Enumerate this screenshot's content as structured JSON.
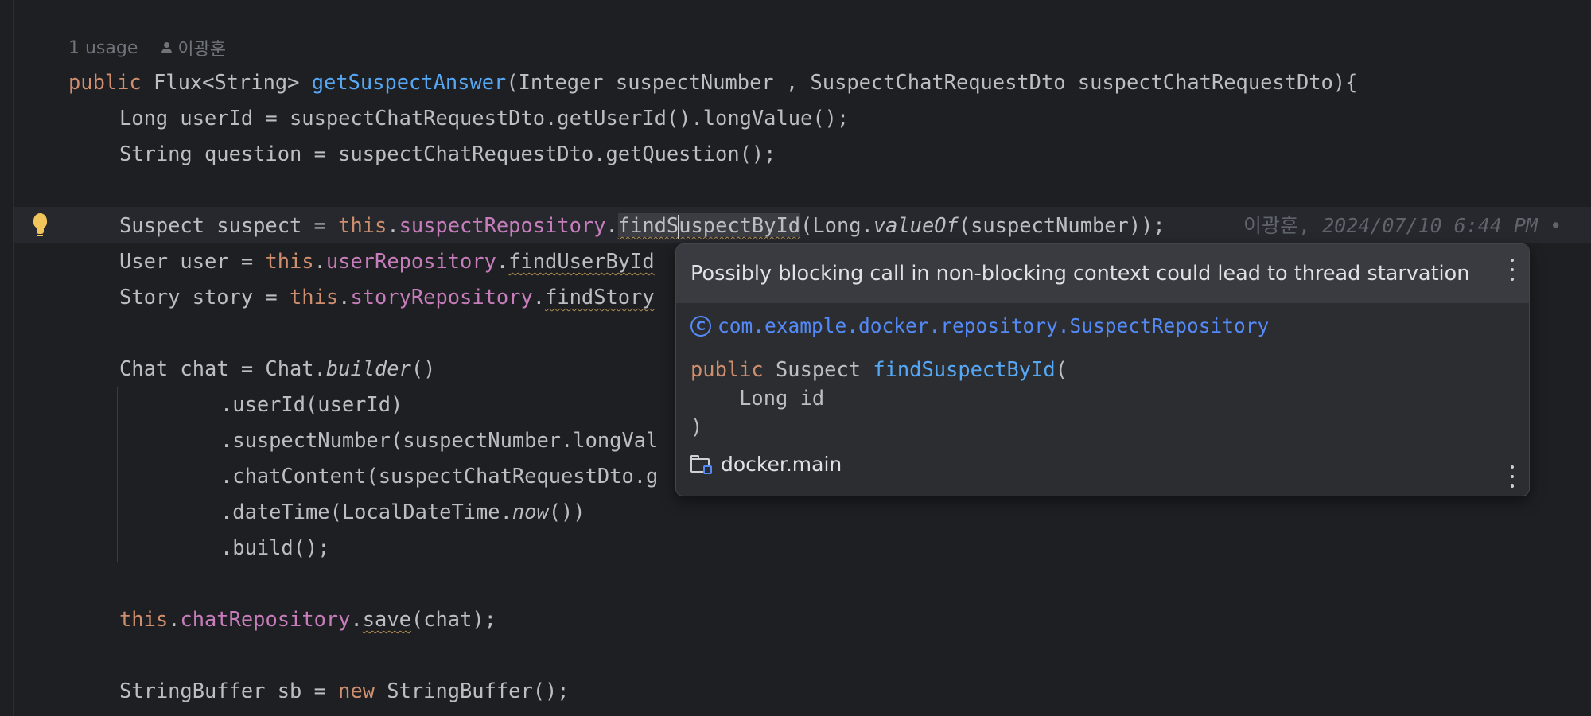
{
  "inlay": {
    "usages": "1 usage",
    "author": "이광훈"
  },
  "code": {
    "l1": {
      "kw": "public ",
      "type": "Flux<String> ",
      "fn": "getSuspectAnswer",
      "params": "(Integer suspectNumber , SuspectChatRequestDto suspectChatRequestDto){"
    },
    "l2": "Long userId = suspectChatRequestDto.getUserId().longValue();",
    "l3": "String question = suspectChatRequestDto.getQuestion();",
    "l4": {
      "pre": "Suspect suspect = ",
      "kw": "this",
      "dot": ".",
      "field": "suspectRepository",
      "dot2": ".",
      "call_a": "findS",
      "call_b": "uspectById",
      "args_a": "(Long.",
      "args_it": "valueOf",
      "args_b": "(suspectNumber));"
    },
    "blame": {
      "author": "이광훈, ",
      "date": "2024/07/10 6:44 PM • "
    },
    "l5": {
      "pre": "User user = ",
      "kw": "this",
      "dot": ".",
      "field": "userRepository",
      "dot2": ".",
      "call": "findUserById"
    },
    "l6": {
      "pre": "Story story = ",
      "kw": "this",
      "dot": ".",
      "field": "storyRepository",
      "dot2": ".",
      "call": "findStory"
    },
    "l7": {
      "pre": "Chat chat = Chat.",
      "it": "builder",
      "post": "()"
    },
    "l8": ".userId(userId)",
    "l9": ".suspectNumber(suspectNumber.longVal",
    "l10": ".chatContent(suspectChatRequestDto.g",
    "l11": {
      "pre": ".dateTime(LocalDateTime.",
      "it": "now",
      "post": "())"
    },
    "l12": ".build();",
    "l13": {
      "kw": "this",
      "dot": ".",
      "field": "chatRepository",
      "dot2": ".",
      "call": "save",
      "post": "(chat);"
    },
    "l14": {
      "pre": "StringBuffer sb = ",
      "kw": "new",
      "post": " StringBuffer();"
    }
  },
  "popup": {
    "message": "Possibly blocking call in non-blocking context could lead to thread starvation",
    "class_icon": "C",
    "class_name": "com.example.docker.repository.SuspectRepository",
    "sig_kw": "public ",
    "sig_type": "Suspect ",
    "sig_fn": "findSuspectById",
    "sig_open": "(",
    "sig_param": "    Long id",
    "sig_close": ")",
    "module": "docker.main"
  },
  "icons": [
    "person-icon",
    "lightbulb-icon",
    "class-icon",
    "folder-module-icon",
    "more-vertical-icon"
  ],
  "colors": {
    "background": "#1e1f22",
    "keyword": "#cf8e6d",
    "function": "#56a8f5",
    "field": "#c77dbb",
    "popup": "#2b2d30",
    "link": "#548af7"
  }
}
